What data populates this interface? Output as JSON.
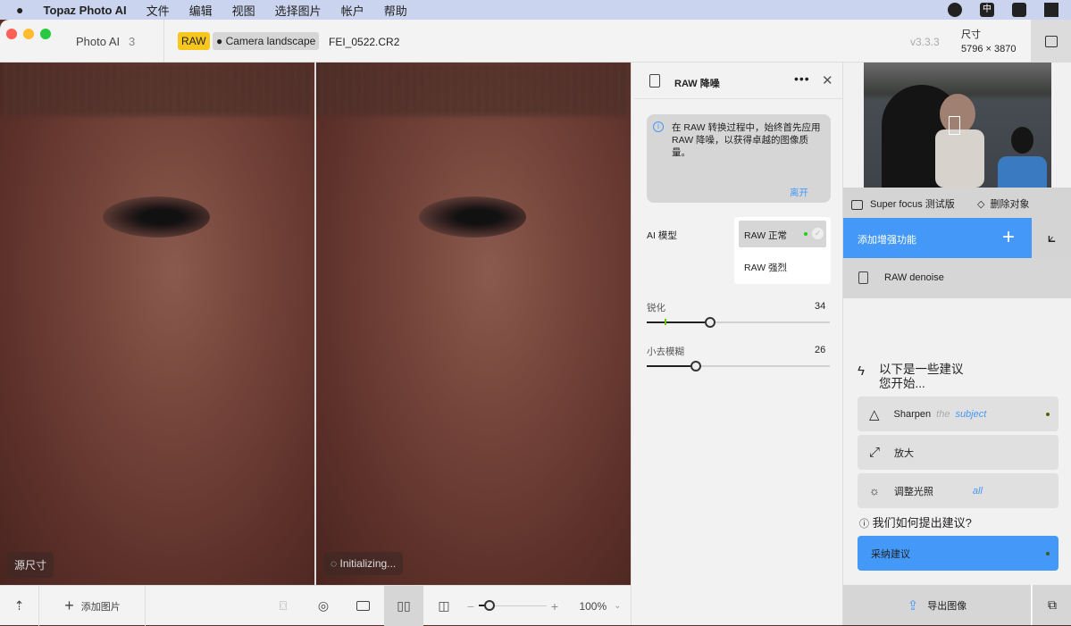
{
  "menubar": {
    "app": "Topaz Photo AI",
    "items": [
      "文件",
      "编辑",
      "视图",
      "选择图片",
      "帐户",
      "帮助"
    ],
    "status_icons": [
      "microphone-icon",
      "input-method-icon",
      "capcut-icon",
      "notification-icon"
    ]
  },
  "titlebar": {
    "app_name": "Photo AI",
    "count": "3",
    "raw_badge": "RAW",
    "preset": "Camera landscape",
    "filename": "FEI_0522.CR2",
    "version": "v3.3.3",
    "size_label": "尺寸",
    "size_value": "5796 × 3870"
  },
  "preview": {
    "left_label": "源尺寸",
    "right_label": "Initializing..."
  },
  "bottombar": {
    "add_image": "添加图片",
    "zoom": "100%",
    "zoom_fraction": 0.12
  },
  "panel": {
    "title": "RAW 降噪",
    "info": "在 RAW 转换过程中，始终首先应用 RAW 降噪，以获得卓越的图像质\n量。",
    "info_link": "离开",
    "model_label": "AI 模型",
    "models": [
      "RAW 正常",
      "RAW 强烈"
    ],
    "selected_model": "RAW 正常",
    "sliders": [
      {
        "label": "锐化",
        "value": 34
      },
      {
        "label": "小去模糊",
        "value": 26
      }
    ]
  },
  "right": {
    "super_focus": "Super focus 测试版",
    "remove_object": "删除对象",
    "add_enhance": "添加增强功能",
    "raw_denoise": "RAW denoise",
    "suggest_title": "以下是一些建议\n您开始...",
    "suggestions": [
      {
        "label": "Sharpen",
        "hint1": "the",
        "hint2": "subject"
      },
      {
        "label": "放大"
      },
      {
        "label": "调整光照",
        "hint2": "all"
      }
    ],
    "how": "我们如何提出建议?",
    "adopt": "采纳建议",
    "export": "导出图像"
  },
  "colors": {
    "accent": "#4499f8",
    "raw_badge": "#f7c71d"
  }
}
